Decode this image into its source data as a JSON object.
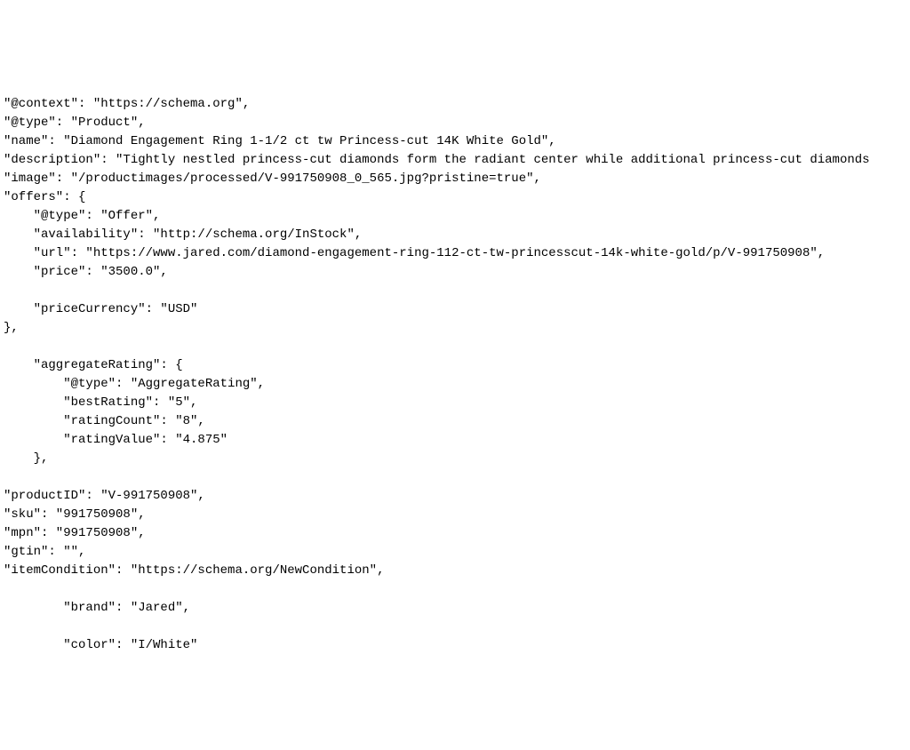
{
  "lines": {
    "l0": "\"@context\": \"https://schema.org\",",
    "l1": "\"@type\": \"Product\",",
    "l2": "\"name\": \"Diamond Engagement Ring 1-1/2 ct tw Princess-cut 14K White Gold\",",
    "l3": "\"description\": \"Tightly nestled princess-cut diamonds form the radiant center while additional princess-cut diamonds",
    "l4": "\"image\": \"/productimages/processed/V-991750908_0_565.jpg?pristine=true\",",
    "l5": "\"offers\": {",
    "l6": "    \"@type\": \"Offer\",",
    "l7": "    \"availability\": \"http://schema.org/InStock\",",
    "l8": "    \"url\": \"https://www.jared.com/diamond-engagement-ring-112-ct-tw-princesscut-14k-white-gold/p/V-991750908\",",
    "l9": "    \"price\": \"3500.0\",",
    "l10": "",
    "l11": "    \"priceCurrency\": \"USD\"",
    "l12": "},",
    "l13": "",
    "l14": "    \"aggregateRating\": {",
    "l15": "        \"@type\": \"AggregateRating\",",
    "l16": "        \"bestRating\": \"5\",",
    "l17": "        \"ratingCount\": \"8\",",
    "l18": "        \"ratingValue\": \"4.875\"",
    "l19": "    },",
    "l20": "",
    "l21": "\"productID\": \"V-991750908\",",
    "l22": "\"sku\": \"991750908\",",
    "l23": "\"mpn\": \"991750908\",",
    "l24": "\"gtin\": \"\",",
    "l25": "\"itemCondition\": \"https://schema.org/NewCondition\",",
    "l26": "",
    "l27": "        \"brand\": \"Jared\",",
    "l28": "",
    "l29": "        \"color\": \"I/White\""
  }
}
